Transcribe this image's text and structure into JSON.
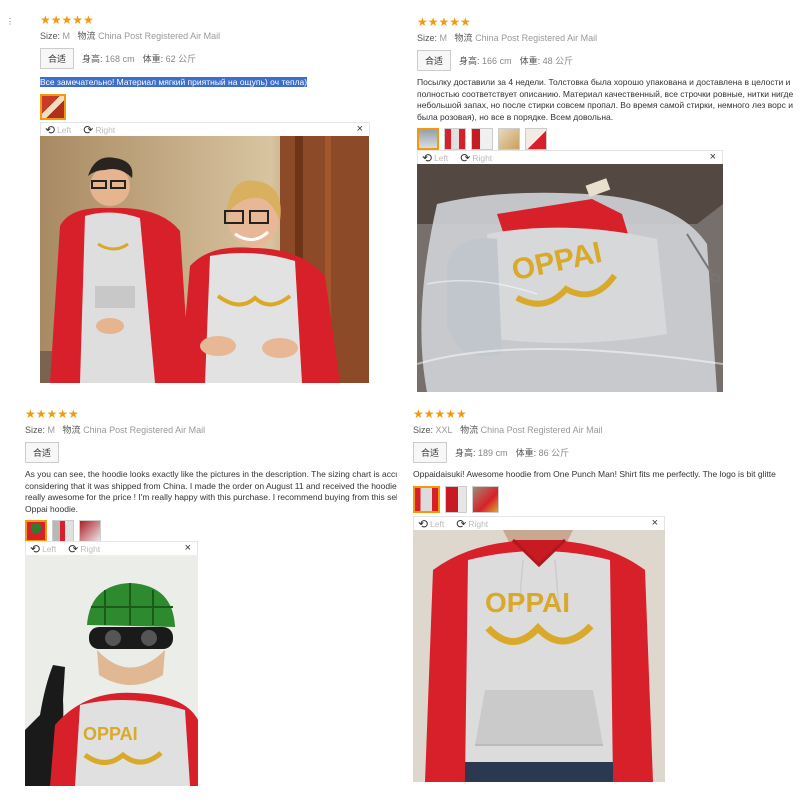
{
  "reviews": [
    {
      "stars": "★★★★★",
      "size_label": "Size:",
      "size": "M",
      "ship_label": "物流",
      "ship": "China Post Registered Air Mail",
      "fit": "合适",
      "height_label": "身高:",
      "height": "168 cm",
      "weight_label": "体重:",
      "weight": "62 公斤",
      "text": [
        "Все замечательно! Материал мягкий приятный на ощупь) оч тепла)"
      ],
      "viewer": {
        "left": "Left",
        "right": "Right",
        "close": "×"
      }
    },
    {
      "stars": "★★★★★",
      "size_label": "Size:",
      "size": "M",
      "ship_label": "物流",
      "ship": "China Post Registered Air Mail",
      "fit": "合适",
      "height_label": "身高:",
      "height": "166 cm",
      "weight_label": "体重:",
      "weight": "48 公斤",
      "text": [
        "Посылку доставили за 4 недели. Толстовка была хорошо упакована и доставлена в целости и сохр",
        "полностью соответствует описанию. Материал качественный, все строчки ровные, нитки нигде н",
        "небольшой запах, но после стирки совсем пропал. Во время самой стирки, немного лез ворс и чу",
        "была розовая), но все в порядке. Всем довольна."
      ],
      "viewer": {
        "left": "Left",
        "right": "Right",
        "close": "×"
      }
    },
    {
      "stars": "★★★★★",
      "size_label": "Size:",
      "size": "M",
      "ship_label": "物流",
      "ship": "China Post Registered Air Mail",
      "fit": "合适",
      "text": [
        "As you can see, the hoodie looks exactly like the pictures in the description. The sizing chart is accurate",
        "considering that it was shipped from China. I made the order on August 11 and received the hoodie or",
        "really awesome for the price ! I'm really happy with this purchase. I recommend buying from this seller",
        "Oppai hoodie."
      ],
      "viewer": {
        "left": "Left",
        "right": "Right",
        "close": "×"
      }
    },
    {
      "stars": "★★★★★",
      "size_label": "Size:",
      "size": "XXL",
      "ship_label": "物流",
      "ship": "China Post Registered Air Mail",
      "fit": "合适",
      "height_label": "身高:",
      "height": "189 cm",
      "weight_label": "体重:",
      "weight": "86 公斤",
      "text": [
        "Oppaidaisuki! Awesome hoodie from One Punch Man! Shirt fits me perfectly. The logo is bit glitte"
      ],
      "viewer": {
        "left": "Left",
        "right": "Right",
        "close": "×"
      }
    }
  ],
  "print_text": "OPPAI",
  "colors": {
    "star": "#f29a0c",
    "highlight": "#3d6fca",
    "hoodie_red": "#d8202a",
    "hoodie_grey": "#dcdcdc",
    "logo_gold": "#d8a92a"
  }
}
